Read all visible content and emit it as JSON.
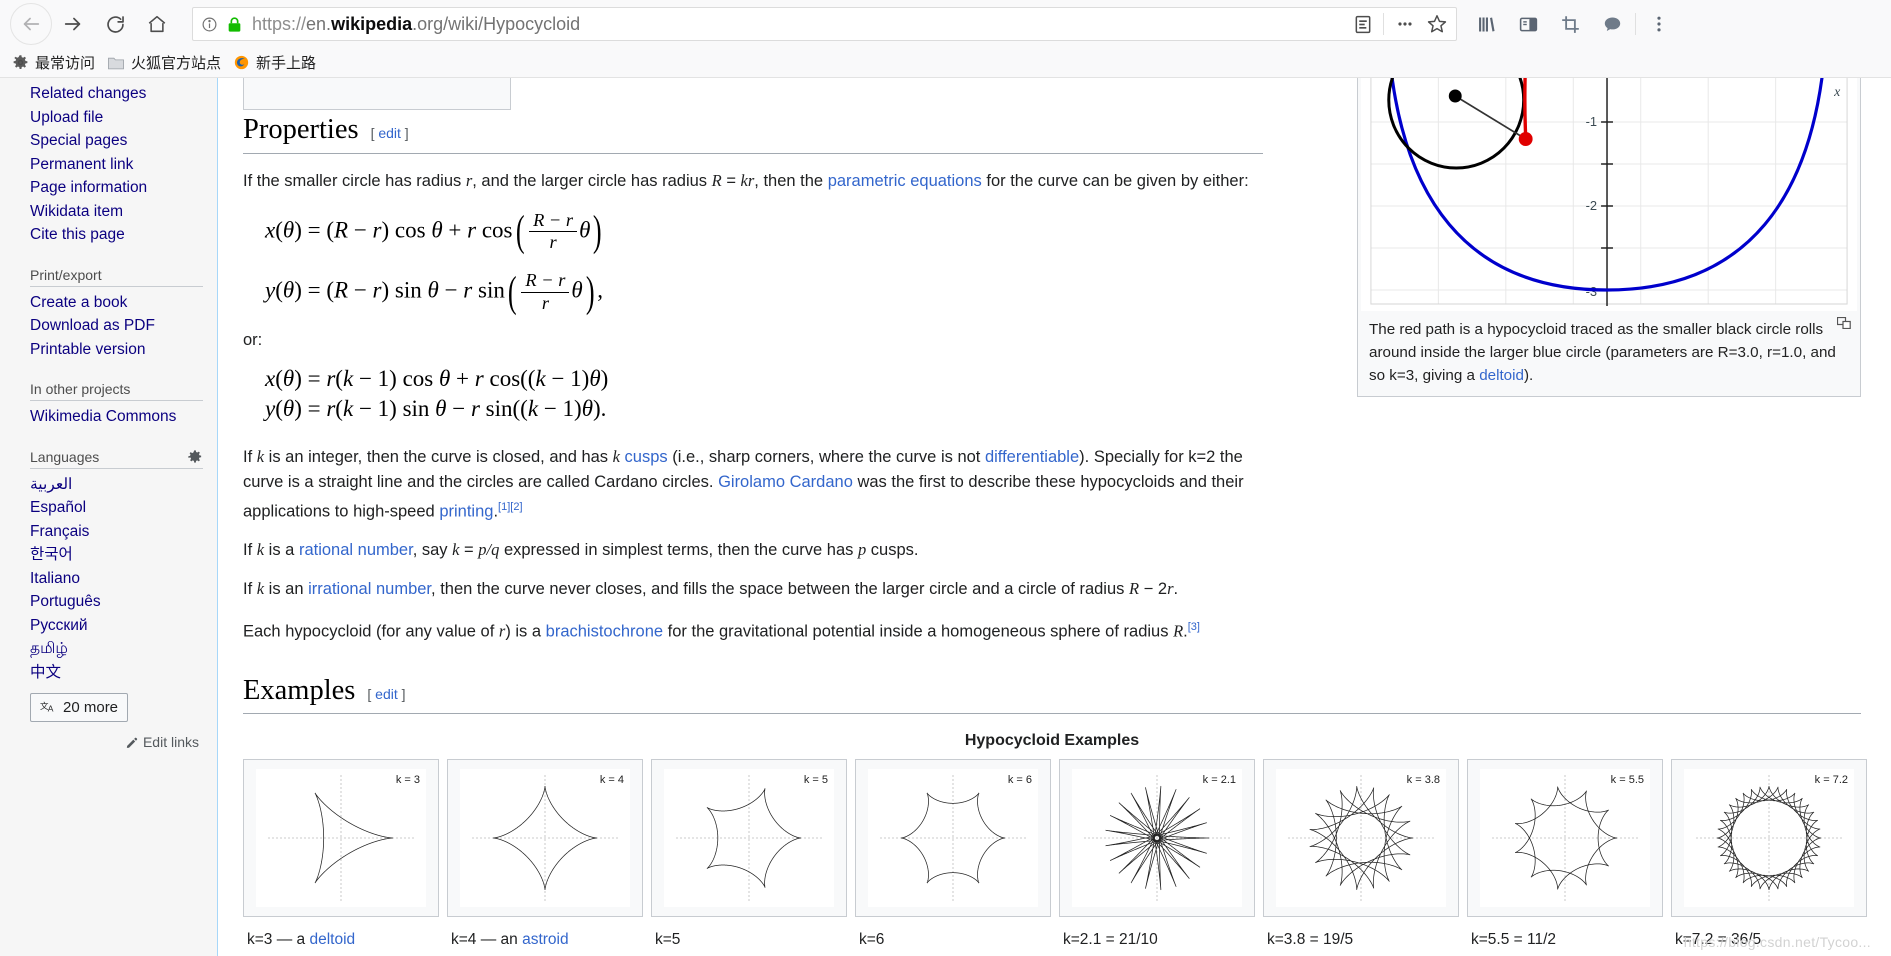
{
  "browser": {
    "back_icon": "back-arrow-icon",
    "forward_icon": "forward-arrow-icon",
    "reload_icon": "reload-icon",
    "home_icon": "home-icon",
    "url_scheme": "https://",
    "url_domain_pre": "en.",
    "url_domain_bold": "wikipedia",
    "url_domain_post": ".org/wiki/Hypocycloid",
    "url_full": "https://en.wikipedia.org/wiki/Hypocycloid",
    "reader_icon": "reader-view-icon",
    "more_icon": "page-actions-ellipsis-icon",
    "bookmark_icon": "bookmark-star-icon",
    "library_icon": "library-icon",
    "sidebar_icon": "sidebars-icon",
    "screenshot_icon": "screenshot-crop-icon",
    "pocket_icon": "pocket-chat-icon",
    "menu_icon": "app-menu-icon",
    "bookmarks": [
      {
        "label": "最常访问",
        "icon": "gear-icon"
      },
      {
        "label": "火狐官方站点",
        "icon": "folder-icon"
      },
      {
        "label": "新手上路",
        "icon": "firefox-icon"
      }
    ]
  },
  "sidebar": {
    "tools_links": [
      "Related changes",
      "Upload file",
      "Special pages",
      "Permanent link",
      "Page information",
      "Wikidata item",
      "Cite this page"
    ],
    "print_heading": "Print/export",
    "print_links": [
      "Create a book",
      "Download as PDF",
      "Printable version"
    ],
    "projects_heading": "In other projects",
    "projects_links": [
      "Wikimedia Commons"
    ],
    "languages_heading": "Languages",
    "languages_gear_icon": "gear-icon",
    "languages": [
      "العربية",
      "Español",
      "Français",
      "한국어",
      "Italiano",
      "Português",
      "Русский",
      "தமிழ்",
      "中文"
    ],
    "more_languages_label": "20 more",
    "more_languages_icon": "language-translate-icon",
    "edit_links_label": "Edit links",
    "edit_links_icon": "pencil-icon"
  },
  "content": {
    "properties": {
      "heading": "Properties",
      "edit_label": "[ edit ]",
      "intro_a": "If the smaller circle has radius ",
      "intro_r": "r",
      "intro_b": ", and the larger circle has radius ",
      "intro_R": "R",
      "intro_eq": " = ",
      "intro_kr": "kr",
      "intro_c": ", then the ",
      "intro_link": "parametric equations",
      "intro_d": " for the curve can be given by either:",
      "either_label": "either:",
      "or_label": "or:",
      "eq1": "x(θ) = (R − r) cos θ + r cos( (R − r)/r θ )",
      "eq2": "y(θ) = (R − r) sin θ − r sin( (R − r)/r θ ),",
      "eq3": "x(θ) = r(k − 1) cos θ + r cos((k − 1)θ)",
      "eq4": "y(θ) = r(k − 1) sin θ − r sin((k − 1)θ).",
      "p_int_1": "If ",
      "p_int_k": "k",
      "p_int_2": " is an integer, then the curve is closed, and has ",
      "p_int_3": " cusps",
      "p_int_4": " (i.e., sharp corners, where the curve is not ",
      "p_int_5": "differentiable",
      "p_int_6": "). Specially for k=2 the curve is a straight line and the circles are called Cardano circles. ",
      "p_int_7": "Girolamo Cardano",
      "p_int_8": " was the first to describe these hypocycloids and their applications to high-speed ",
      "p_int_9": "printing",
      "ref1": "[1]",
      "ref2": "[2]",
      "p_rat_1": "If ",
      "p_rat_k": "k",
      "p_rat_2": " is a ",
      "p_rat_link": "rational number",
      "p_rat_3": ", say ",
      "p_rat_eq": "k",
      "p_rat_4": " = ",
      "p_rat_pq": "p/q",
      "p_rat_5": " expressed in simplest terms, then the curve has ",
      "p_rat_p": "p",
      "p_rat_6": " cusps.",
      "p_irr_1": "If ",
      "p_irr_k": "k",
      "p_irr_2": " is an ",
      "p_irr_link": "irrational number",
      "p_irr_3": ", then the curve never closes, and fills the space between the larger circle and a circle of radius ",
      "p_irr_R": "R",
      "p_irr_4": " − 2",
      "p_irr_r": "r",
      "p_irr_5": ".",
      "p_bra_1": "Each hypocycloid (for any value of ",
      "p_bra_r": "r",
      "p_bra_2": ") is a ",
      "p_bra_link": "brachistochrone",
      "p_bra_3": " for the gravitational potential inside a homogeneous sphere of radius ",
      "p_bra_R": "R",
      "p_bra_4": ".",
      "ref3": "[3]"
    },
    "figure": {
      "caption_a": "The red path is a hypocycloid traced as the smaller black circle rolls around inside the larger blue circle (parameters are R=3.0, r=1.0, and so k=3, giving a ",
      "caption_link": "deltoid",
      "caption_b": ").",
      "magnify_icon": "magnify-enlarge-icon",
      "axis_label_x": "x",
      "y_ticks": [
        "-1",
        "-2",
        "-3"
      ],
      "params": {
        "R": "3.0",
        "r": "1.0",
        "k": "3"
      }
    },
    "examples": {
      "heading": "Examples",
      "edit_label": "[ edit ]",
      "gallery_title": "Hypocycloid Examples",
      "items": [
        {
          "k_label": "k = 3",
          "caption_pre": "k=3 — a ",
          "caption_link": "deltoid",
          "caption_post": "",
          "k": 3,
          "cusps": 3
        },
        {
          "k_label": "k = 4",
          "caption_pre": "k=4 — an ",
          "caption_link": "astroid",
          "caption_post": "",
          "k": 4,
          "cusps": 4
        },
        {
          "k_label": "k = 5",
          "caption_pre": "k=5",
          "caption_link": "",
          "caption_post": "",
          "k": 5,
          "cusps": 5
        },
        {
          "k_label": "k = 6",
          "caption_pre": "k=6",
          "caption_link": "",
          "caption_post": "",
          "k": 6,
          "cusps": 6
        },
        {
          "k_label": "k = 2.1",
          "caption_pre": "k=2.1 = 21/10",
          "caption_link": "",
          "caption_post": "",
          "k": 2.1,
          "cusps": 21
        },
        {
          "k_label": "k = 3.8",
          "caption_pre": "k=3.8 = 19/5",
          "caption_link": "",
          "caption_post": "",
          "k": 3.8,
          "cusps": 19
        },
        {
          "k_label": "k = 5.5",
          "caption_pre": "k=5.5 = 11/2",
          "caption_link": "",
          "caption_post": "",
          "k": 5.5,
          "cusps": 11
        },
        {
          "k_label": "k = 7.2",
          "caption_pre": "k=7.2 = 36/5",
          "caption_link": "",
          "caption_post": "",
          "k": 7.2,
          "cusps": 36
        }
      ]
    },
    "watermark": "https://blog.csdn.net/Tycoo..."
  },
  "colors": {
    "link": "#3366cc",
    "sidebar_link": "#0b0080",
    "curve_blue": "#0000cc",
    "curve_red": "#e00000",
    "chrome_bg": "#f9f9fa"
  }
}
